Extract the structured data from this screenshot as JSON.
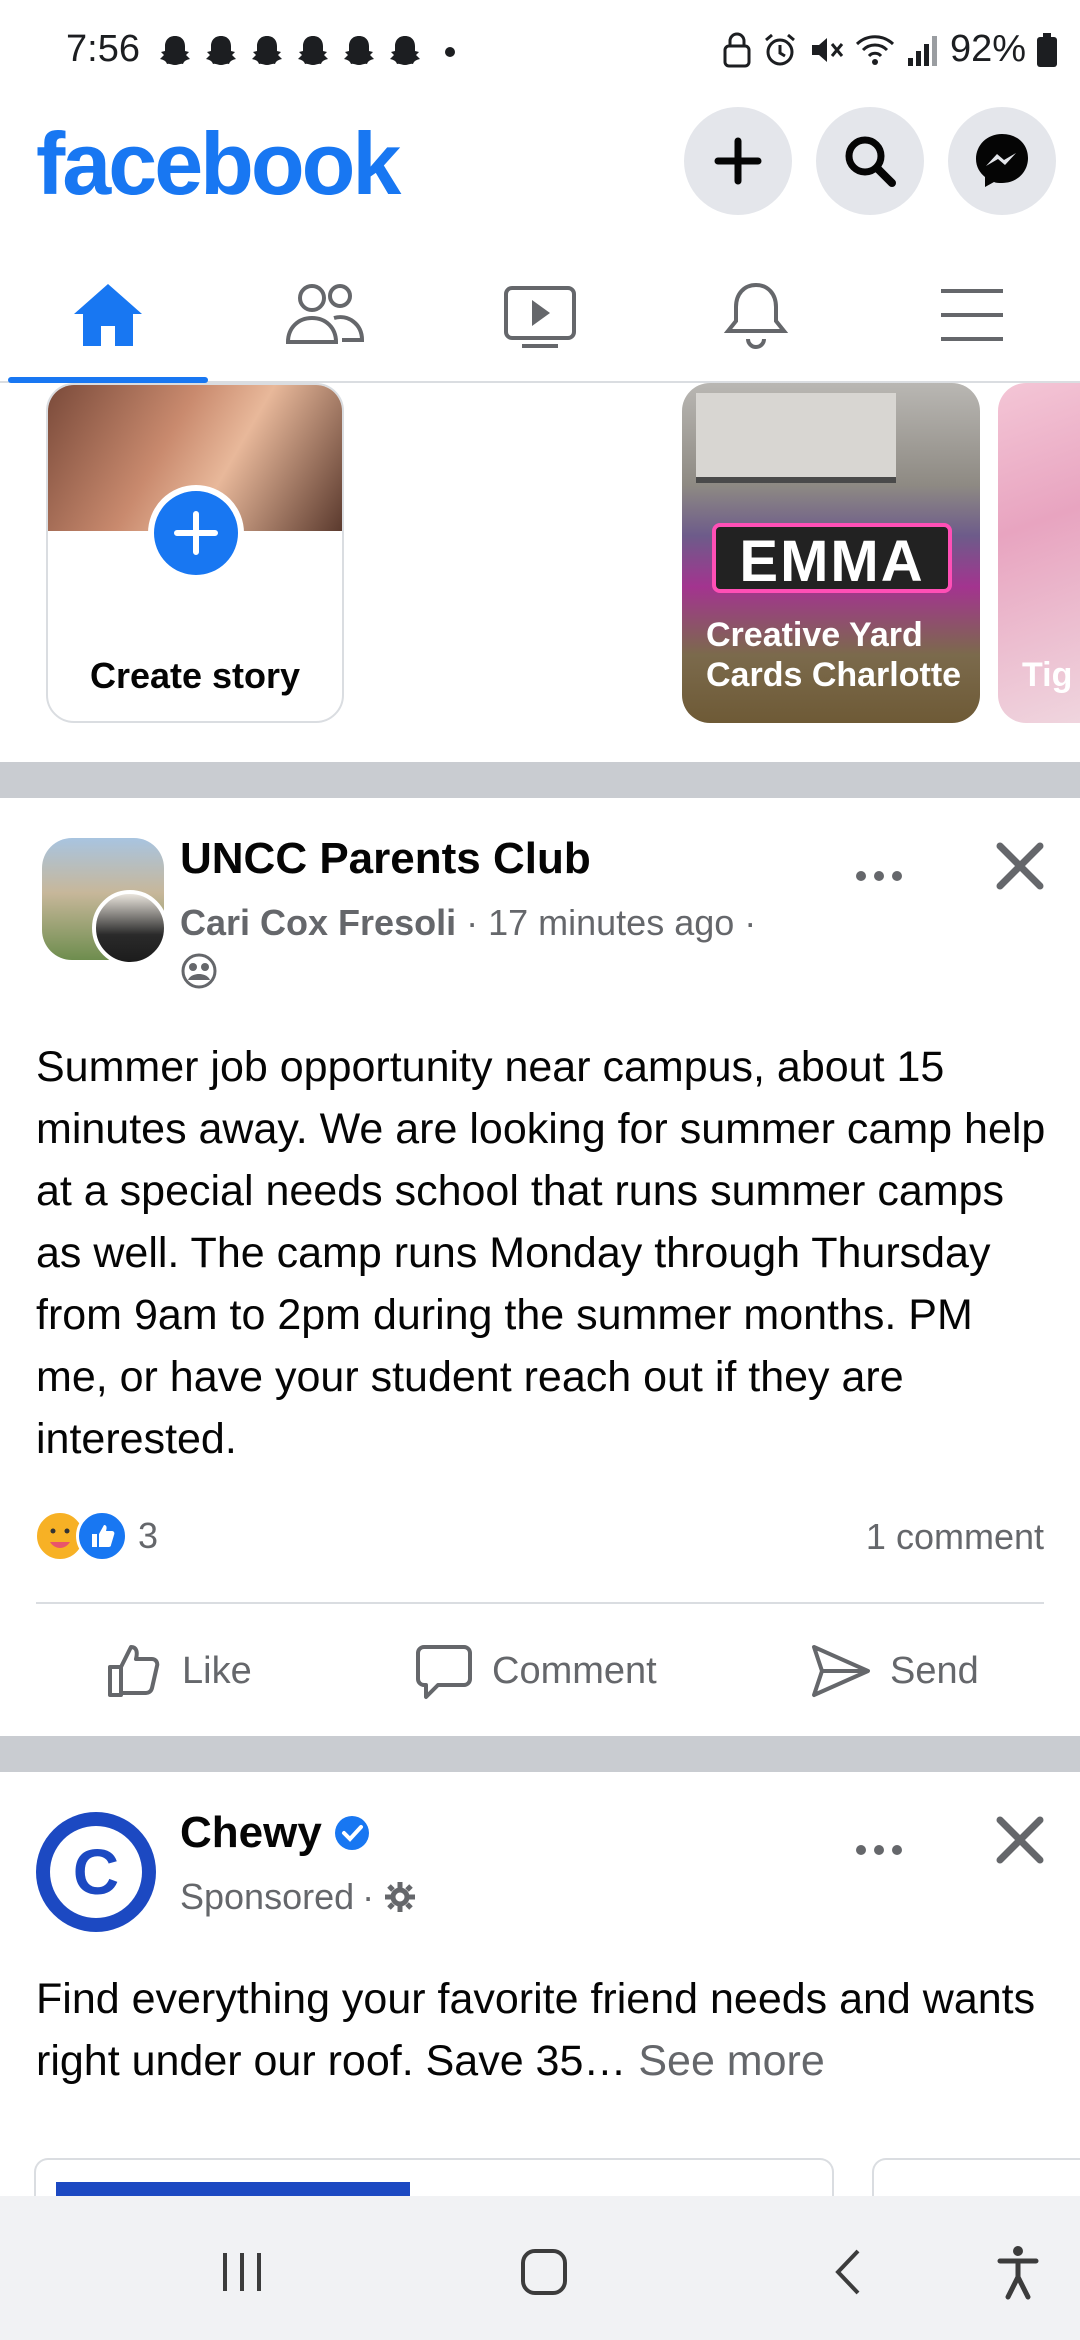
{
  "status_bar": {
    "time": "7:56",
    "battery": "92%"
  },
  "header": {
    "logo": "facebook"
  },
  "tabs": [
    {
      "name": "home",
      "active": true
    },
    {
      "name": "friends",
      "active": false
    },
    {
      "name": "watch",
      "active": false
    },
    {
      "name": "notifications",
      "active": false
    },
    {
      "name": "menu",
      "active": false
    }
  ],
  "stories": {
    "create_label": "Create story",
    "items": [
      {
        "title": "Creative Yard Cards Charlotte",
        "sign_text": "EMMA"
      },
      {
        "title": "Tig"
      }
    ]
  },
  "post1": {
    "group": "UNCC Parents Club",
    "author": "Cari Cox Fresoli",
    "time": "17 minutes ago",
    "text": "Summer job opportunity near campus, about 15 minutes away. We are looking for summer camp help at a special needs school that runs summer camps as well. The camp runs Monday through Thursday from 9am to 2pm during the summer months. PM me, or have your student reach out if they are interested.",
    "reaction_count": "3",
    "comment_count": "1 comment",
    "actions": {
      "like": "Like",
      "comment": "Comment",
      "send": "Send"
    }
  },
  "post2": {
    "page": "Chewy",
    "avatar_letter": "C",
    "sponsored": "Sponsored",
    "text": "Find everything your favorite friend needs and wants right under our roof. Save 35…",
    "see_more": "See more"
  },
  "colors": {
    "brand": "#1877f2",
    "chewy": "#1c49c2"
  }
}
